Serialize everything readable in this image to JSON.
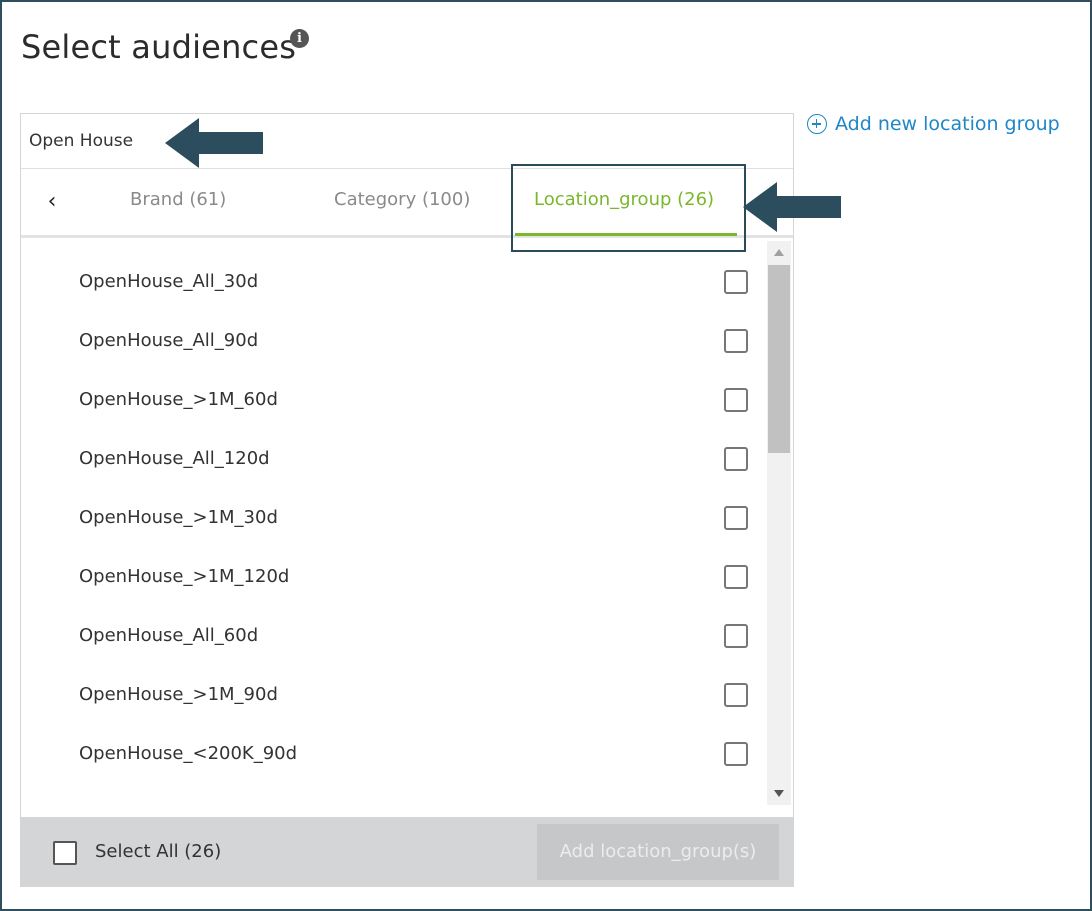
{
  "page": {
    "title": "Select audiences",
    "info_icon": "info-icon",
    "add_new_link": "Add new location group"
  },
  "search": {
    "value": "Open House"
  },
  "tabs": {
    "back_icon": "‹",
    "items": [
      {
        "label": "Brand (61)",
        "active": false
      },
      {
        "label": "Category (100)",
        "active": false
      },
      {
        "label": "Location_group (26)",
        "active": true
      }
    ],
    "active_color": "#7ab72b"
  },
  "list": {
    "items": [
      {
        "label": "OpenHouse_All_30d",
        "checked": false
      },
      {
        "label": "OpenHouse_All_90d",
        "checked": false
      },
      {
        "label": "OpenHouse_>1M_60d",
        "checked": false
      },
      {
        "label": "OpenHouse_All_120d",
        "checked": false
      },
      {
        "label": "OpenHouse_>1M_30d",
        "checked": false
      },
      {
        "label": "OpenHouse_>1M_120d",
        "checked": false
      },
      {
        "label": "OpenHouse_All_60d",
        "checked": false
      },
      {
        "label": "OpenHouse_>1M_90d",
        "checked": false
      },
      {
        "label": "OpenHouse_<200K_90d",
        "checked": false
      }
    ]
  },
  "footer": {
    "select_all_label": "Select All (26)",
    "add_button_label": "Add location_group(s)"
  },
  "annotations": {
    "arrow_color": "#2c4d5d"
  }
}
